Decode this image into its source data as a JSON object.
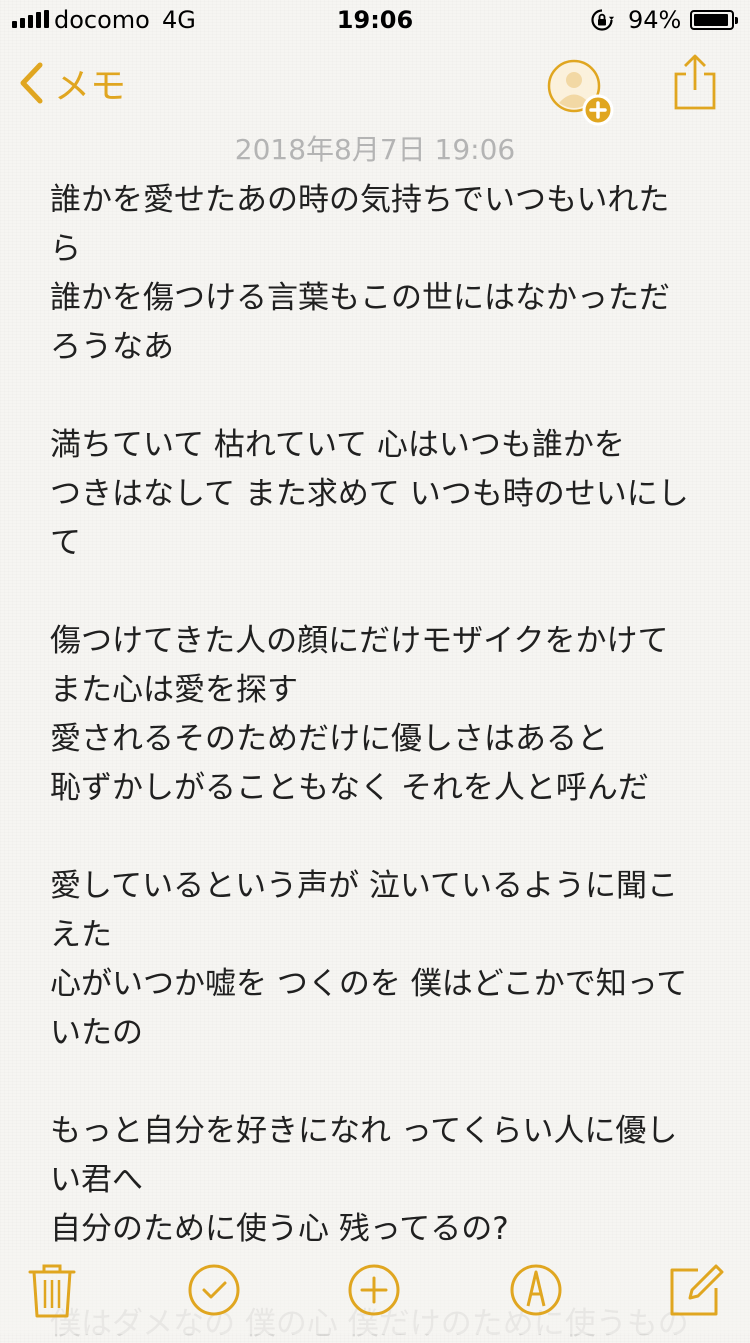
{
  "status_bar": {
    "carrier": "docomo",
    "network": "4G",
    "time": "19:06",
    "battery_percent": "94%",
    "battery_level": 0.94
  },
  "nav": {
    "back_label": "メモ",
    "icons": {
      "back": "chevron-left-icon",
      "add_person": "add-person-icon",
      "share": "share-icon"
    },
    "accent_color": "#e0a620"
  },
  "note": {
    "date": "2018年8月7日 19:06",
    "lines": [
      "誰かを愛せたあの時の気持ちでいつもいれた",
      "ら",
      "誰かを傷つける言葉もこの世にはなかっただ",
      "ろうなあ",
      "",
      "満ちていて 枯れていて 心はいつも誰かを",
      "つきはなして また求めて いつも時のせいにし",
      "て",
      "",
      "傷つけてきた人の顔にだけモザイクをかけて",
      "また心は愛を探す",
      "愛されるそのためだけに優しさはあると",
      "恥ずかしがることもなく それを人と呼んだ",
      "",
      "愛しているという声が 泣いているように聞こ",
      "えた",
      "心がいつか嘘を つくのを 僕はどこかで知って",
      "いたの",
      "",
      "もっと自分を好きになれ ってくらい人に優し",
      "い君へ",
      "自分のために使う心 残ってるの?"
    ],
    "faded_line": "僕はダメなの 僕の心 僕だけのために使うもの"
  },
  "toolbar": {
    "icons": [
      "trash-icon",
      "checklist-icon",
      "add-icon",
      "sketch-icon",
      "compose-icon"
    ]
  }
}
